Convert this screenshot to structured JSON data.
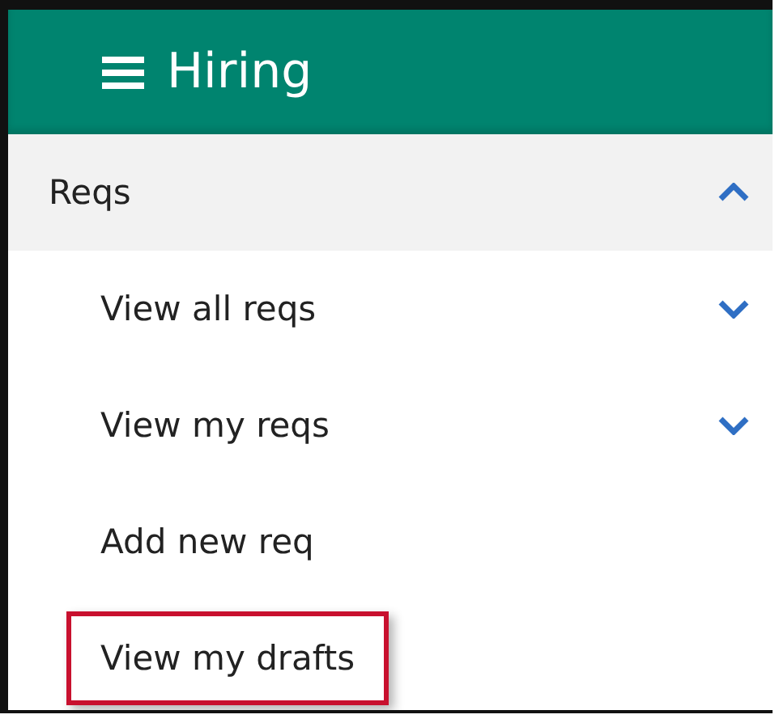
{
  "header": {
    "title": "Hiring"
  },
  "section": {
    "label": "Reqs",
    "expanded": true
  },
  "items": [
    {
      "label": "View all reqs",
      "kind": "submenu",
      "expanded": false,
      "highlighted": false
    },
    {
      "label": "View my reqs",
      "kind": "submenu",
      "expanded": false,
      "highlighted": false
    },
    {
      "label": "Add new req",
      "kind": "link",
      "highlighted": false
    },
    {
      "label": "View my drafts",
      "kind": "link",
      "highlighted": true
    }
  ]
}
